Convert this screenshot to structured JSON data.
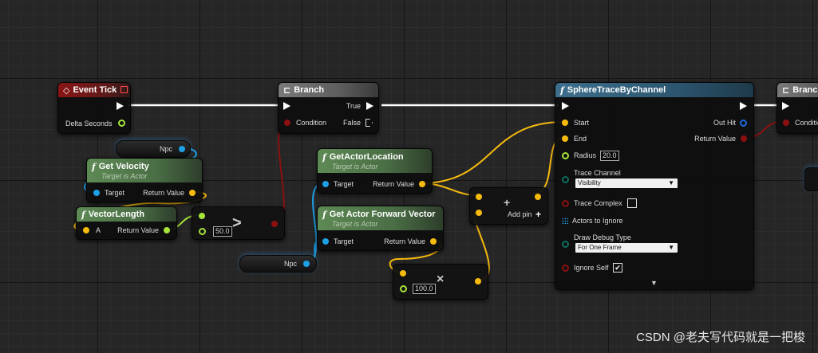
{
  "watermark": "CSDN @老夫写代码就是一把梭",
  "colors": {
    "exec": "#ffffff",
    "bool": "#8c1010",
    "float": "#a7e43a",
    "vector": "#f7bb0f",
    "object": "#1ea0e6",
    "enum": "#0b6d5e"
  },
  "event_tick": {
    "title": "Event Tick",
    "delta_seconds": "Delta Seconds"
  },
  "branch1": {
    "title": "Branch",
    "true_label": "True",
    "false_label": "False",
    "condition": "Condition"
  },
  "branch2": {
    "title": "Branch",
    "condition": "Conditio"
  },
  "npc_var_top": {
    "label": "Npc"
  },
  "npc_var_bottom": {
    "label": "Npc"
  },
  "get_velocity": {
    "title": "Get Velocity",
    "subtitle": "Target is Actor",
    "target": "Target",
    "return_value": "Return Value"
  },
  "vector_length": {
    "title": "VectorLength",
    "a": "A",
    "return_value": "Return Value"
  },
  "greater": {
    "value": "50.0",
    "symbol": ">"
  },
  "get_actor_location": {
    "title": "GetActorLocation",
    "subtitle": "Target is Actor",
    "target": "Target",
    "return_value": "Return Value"
  },
  "get_forward_vector": {
    "title": "Get Actor Forward Vector",
    "subtitle": "Target is Actor",
    "target": "Target",
    "return_value": "Return Value"
  },
  "multiply": {
    "value": "100.0",
    "symbol": "×"
  },
  "add": {
    "add_pin": "Add pin",
    "plus": "+"
  },
  "sphere_trace": {
    "title": "SphereTraceByChannel",
    "start": "Start",
    "end": "End",
    "radius_label": "Radius",
    "radius_value": "20.0",
    "trace_channel_label": "Trace Channel",
    "trace_channel_value": "Visibility",
    "trace_complex_label": "Trace Complex",
    "actors_to_ignore": "Actors to Ignore",
    "draw_debug_label": "Draw Debug Type",
    "draw_debug_value": "For One Frame",
    "ignore_self_label": "Ignore Self",
    "ignore_self_check": "✔",
    "out_hit": "Out Hit",
    "return_value": "Return Value",
    "expand": "▼"
  }
}
